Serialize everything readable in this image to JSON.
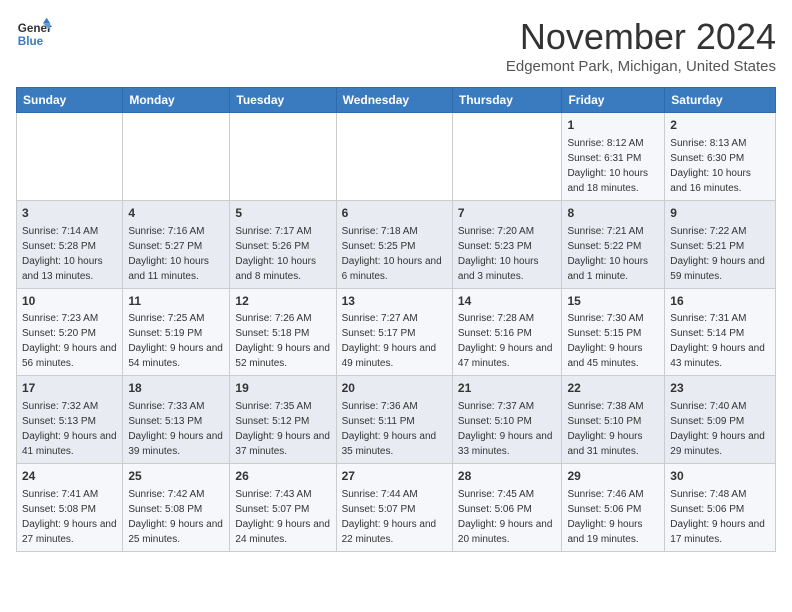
{
  "header": {
    "logo_line1": "General",
    "logo_line2": "Blue",
    "month": "November 2024",
    "location": "Edgemont Park, Michigan, United States"
  },
  "days_of_week": [
    "Sunday",
    "Monday",
    "Tuesday",
    "Wednesday",
    "Thursday",
    "Friday",
    "Saturday"
  ],
  "weeks": [
    [
      {
        "day": "",
        "info": ""
      },
      {
        "day": "",
        "info": ""
      },
      {
        "day": "",
        "info": ""
      },
      {
        "day": "",
        "info": ""
      },
      {
        "day": "",
        "info": ""
      },
      {
        "day": "1",
        "info": "Sunrise: 8:12 AM\nSunset: 6:31 PM\nDaylight: 10 hours and 18 minutes."
      },
      {
        "day": "2",
        "info": "Sunrise: 8:13 AM\nSunset: 6:30 PM\nDaylight: 10 hours and 16 minutes."
      }
    ],
    [
      {
        "day": "3",
        "info": "Sunrise: 7:14 AM\nSunset: 5:28 PM\nDaylight: 10 hours and 13 minutes."
      },
      {
        "day": "4",
        "info": "Sunrise: 7:16 AM\nSunset: 5:27 PM\nDaylight: 10 hours and 11 minutes."
      },
      {
        "day": "5",
        "info": "Sunrise: 7:17 AM\nSunset: 5:26 PM\nDaylight: 10 hours and 8 minutes."
      },
      {
        "day": "6",
        "info": "Sunrise: 7:18 AM\nSunset: 5:25 PM\nDaylight: 10 hours and 6 minutes."
      },
      {
        "day": "7",
        "info": "Sunrise: 7:20 AM\nSunset: 5:23 PM\nDaylight: 10 hours and 3 minutes."
      },
      {
        "day": "8",
        "info": "Sunrise: 7:21 AM\nSunset: 5:22 PM\nDaylight: 10 hours and 1 minute."
      },
      {
        "day": "9",
        "info": "Sunrise: 7:22 AM\nSunset: 5:21 PM\nDaylight: 9 hours and 59 minutes."
      }
    ],
    [
      {
        "day": "10",
        "info": "Sunrise: 7:23 AM\nSunset: 5:20 PM\nDaylight: 9 hours and 56 minutes."
      },
      {
        "day": "11",
        "info": "Sunrise: 7:25 AM\nSunset: 5:19 PM\nDaylight: 9 hours and 54 minutes."
      },
      {
        "day": "12",
        "info": "Sunrise: 7:26 AM\nSunset: 5:18 PM\nDaylight: 9 hours and 52 minutes."
      },
      {
        "day": "13",
        "info": "Sunrise: 7:27 AM\nSunset: 5:17 PM\nDaylight: 9 hours and 49 minutes."
      },
      {
        "day": "14",
        "info": "Sunrise: 7:28 AM\nSunset: 5:16 PM\nDaylight: 9 hours and 47 minutes."
      },
      {
        "day": "15",
        "info": "Sunrise: 7:30 AM\nSunset: 5:15 PM\nDaylight: 9 hours and 45 minutes."
      },
      {
        "day": "16",
        "info": "Sunrise: 7:31 AM\nSunset: 5:14 PM\nDaylight: 9 hours and 43 minutes."
      }
    ],
    [
      {
        "day": "17",
        "info": "Sunrise: 7:32 AM\nSunset: 5:13 PM\nDaylight: 9 hours and 41 minutes."
      },
      {
        "day": "18",
        "info": "Sunrise: 7:33 AM\nSunset: 5:13 PM\nDaylight: 9 hours and 39 minutes."
      },
      {
        "day": "19",
        "info": "Sunrise: 7:35 AM\nSunset: 5:12 PM\nDaylight: 9 hours and 37 minutes."
      },
      {
        "day": "20",
        "info": "Sunrise: 7:36 AM\nSunset: 5:11 PM\nDaylight: 9 hours and 35 minutes."
      },
      {
        "day": "21",
        "info": "Sunrise: 7:37 AM\nSunset: 5:10 PM\nDaylight: 9 hours and 33 minutes."
      },
      {
        "day": "22",
        "info": "Sunrise: 7:38 AM\nSunset: 5:10 PM\nDaylight: 9 hours and 31 minutes."
      },
      {
        "day": "23",
        "info": "Sunrise: 7:40 AM\nSunset: 5:09 PM\nDaylight: 9 hours and 29 minutes."
      }
    ],
    [
      {
        "day": "24",
        "info": "Sunrise: 7:41 AM\nSunset: 5:08 PM\nDaylight: 9 hours and 27 minutes."
      },
      {
        "day": "25",
        "info": "Sunrise: 7:42 AM\nSunset: 5:08 PM\nDaylight: 9 hours and 25 minutes."
      },
      {
        "day": "26",
        "info": "Sunrise: 7:43 AM\nSunset: 5:07 PM\nDaylight: 9 hours and 24 minutes."
      },
      {
        "day": "27",
        "info": "Sunrise: 7:44 AM\nSunset: 5:07 PM\nDaylight: 9 hours and 22 minutes."
      },
      {
        "day": "28",
        "info": "Sunrise: 7:45 AM\nSunset: 5:06 PM\nDaylight: 9 hours and 20 minutes."
      },
      {
        "day": "29",
        "info": "Sunrise: 7:46 AM\nSunset: 5:06 PM\nDaylight: 9 hours and 19 minutes."
      },
      {
        "day": "30",
        "info": "Sunrise: 7:48 AM\nSunset: 5:06 PM\nDaylight: 9 hours and 17 minutes."
      }
    ]
  ]
}
